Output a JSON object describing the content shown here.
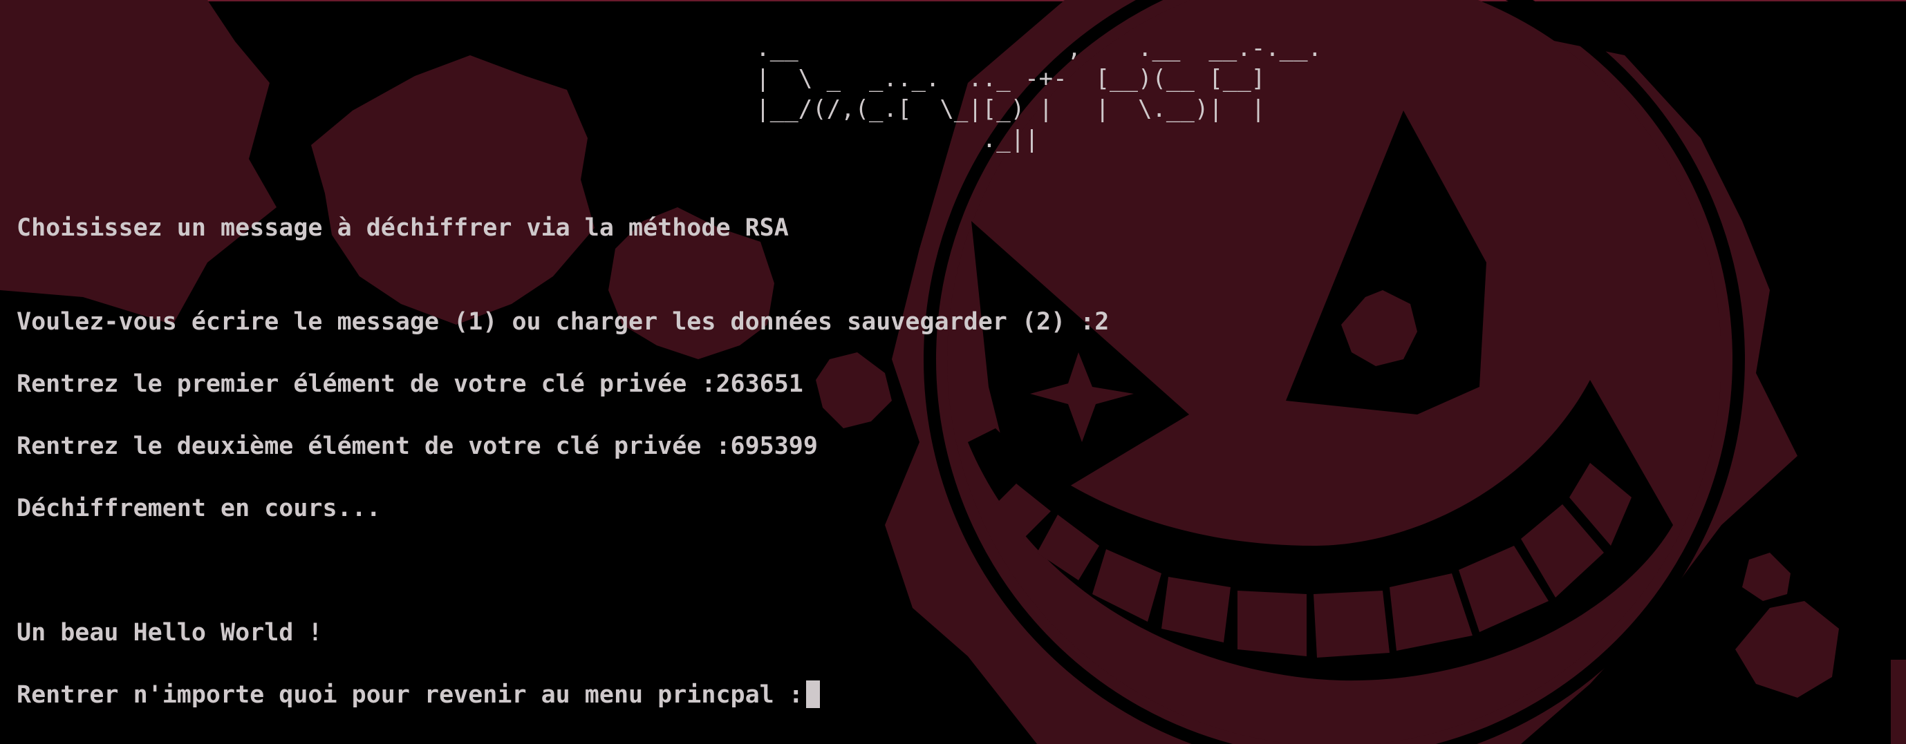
{
  "theme": {
    "background": "#000000",
    "art_color": "#3d0f19",
    "text_color": "#cfc9cb"
  },
  "banner": {
    "line1": "       .__                   ,    .__  __.-.__.",
    "line2": "       |  \\ _  _.._.  .._ -+-  [__)(__ [__]",
    "line3": "       |__/(/,(_.[  \\_|[_) |   |  \\.__)|  |",
    "line4": "                       ._||"
  },
  "console": {
    "title": "Choisissez un message à déchiffrer via la méthode RSA",
    "mode_prompt": "Voulez-vous écrire le message (1) ou charger les données sauvegarder (2) :2",
    "key1_prompt": "Rentrez le premier élément de votre clé privée :263651",
    "key2_prompt": "Rentrez le deuxième élément de votre clé privée :695399",
    "status": "Déchiffrement en cours...",
    "result": "Un beau Hello World !",
    "return_prompt": "Rentrer n'importe quoi pour revenir au menu princpal :"
  },
  "background_art": {
    "subject": "grinning-moon-face-icon"
  }
}
